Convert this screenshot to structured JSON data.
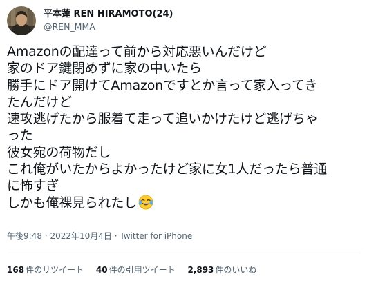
{
  "author": {
    "display_name": "平本蓮 REN HIRAMOTO(24)",
    "handle": "@REN_MMA",
    "avatar": "profile-photo"
  },
  "tweet": {
    "lines": [
      "Amazonの配達って前から対応悪いんだけど",
      "家のドア鍵閉めずに家の中いたら",
      "勝手にドア開けてAmazonですとか言って家入ってき",
      "たんだけど",
      "速攻逃げたから服着て走って追いかけたけど逃げちゃ",
      "った",
      "彼女宛の荷物だし",
      "これ俺がいたからよかったけど家に女1人だったら普通",
      "に怖すぎ",
      "しかも俺裸見られたし"
    ],
    "emoji": "face-with-tears-of-joy"
  },
  "meta": {
    "time": "午後9:48",
    "separator": "·",
    "date": "2022年10月4日",
    "source": "Twitter for iPhone"
  },
  "stats": {
    "retweets_count": "168",
    "retweets_label": "件のリツイート",
    "quotes_count": "40",
    "quotes_label": "件の引用ツイート",
    "likes_count": "2,893",
    "likes_label": "件のいいね"
  }
}
